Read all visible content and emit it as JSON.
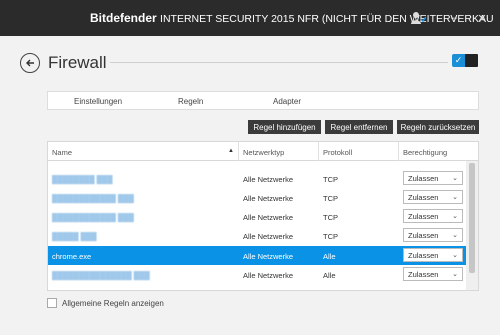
{
  "titlebar": {
    "brand": "Bitdefender",
    "product": "INTERNET SECURITY 2015 NFR (NICHT FÜR DEN WEITERVERKAU",
    "minimize": "–",
    "close": "✕"
  },
  "header": {
    "title": "Firewall",
    "toggle_check": "✓"
  },
  "tabs": [
    "Einstellungen",
    "Regeln",
    "Adapter"
  ],
  "actions": {
    "add": "Regel hinzufügen",
    "remove": "Regel entfernen",
    "reset": "Regeln zurücksetzen"
  },
  "table": {
    "columns": [
      "Name",
      "Netzwerktyp",
      "Protokoll",
      "Berechtigung"
    ],
    "sort_indicator": "▲",
    "rows": [
      {
        "name": "",
        "network": "Alle Netzwerke",
        "protocol": "TCP",
        "permission": "Zulassen"
      },
      {
        "name": "",
        "network": "Alle Netzwerke",
        "protocol": "TCP",
        "permission": "Zulassen"
      },
      {
        "name": "",
        "network": "Alle Netzwerke",
        "protocol": "TCP",
        "permission": "Zulassen"
      },
      {
        "name": "",
        "network": "Alle Netzwerke",
        "protocol": "TCP",
        "permission": "Zulassen"
      },
      {
        "name": "chrome.exe",
        "network": "Alle Netzwerke",
        "protocol": "Alle",
        "permission": "Zulassen"
      },
      {
        "name": "",
        "network": "Alle Netzwerke",
        "protocol": "Alle",
        "permission": "Zulassen"
      }
    ]
  },
  "footer": {
    "show_general_rules": "Allgemeine Regeln anzeigen"
  },
  "colors": {
    "accent": "#0a93e6",
    "titlebar": "#2b2b2b"
  }
}
